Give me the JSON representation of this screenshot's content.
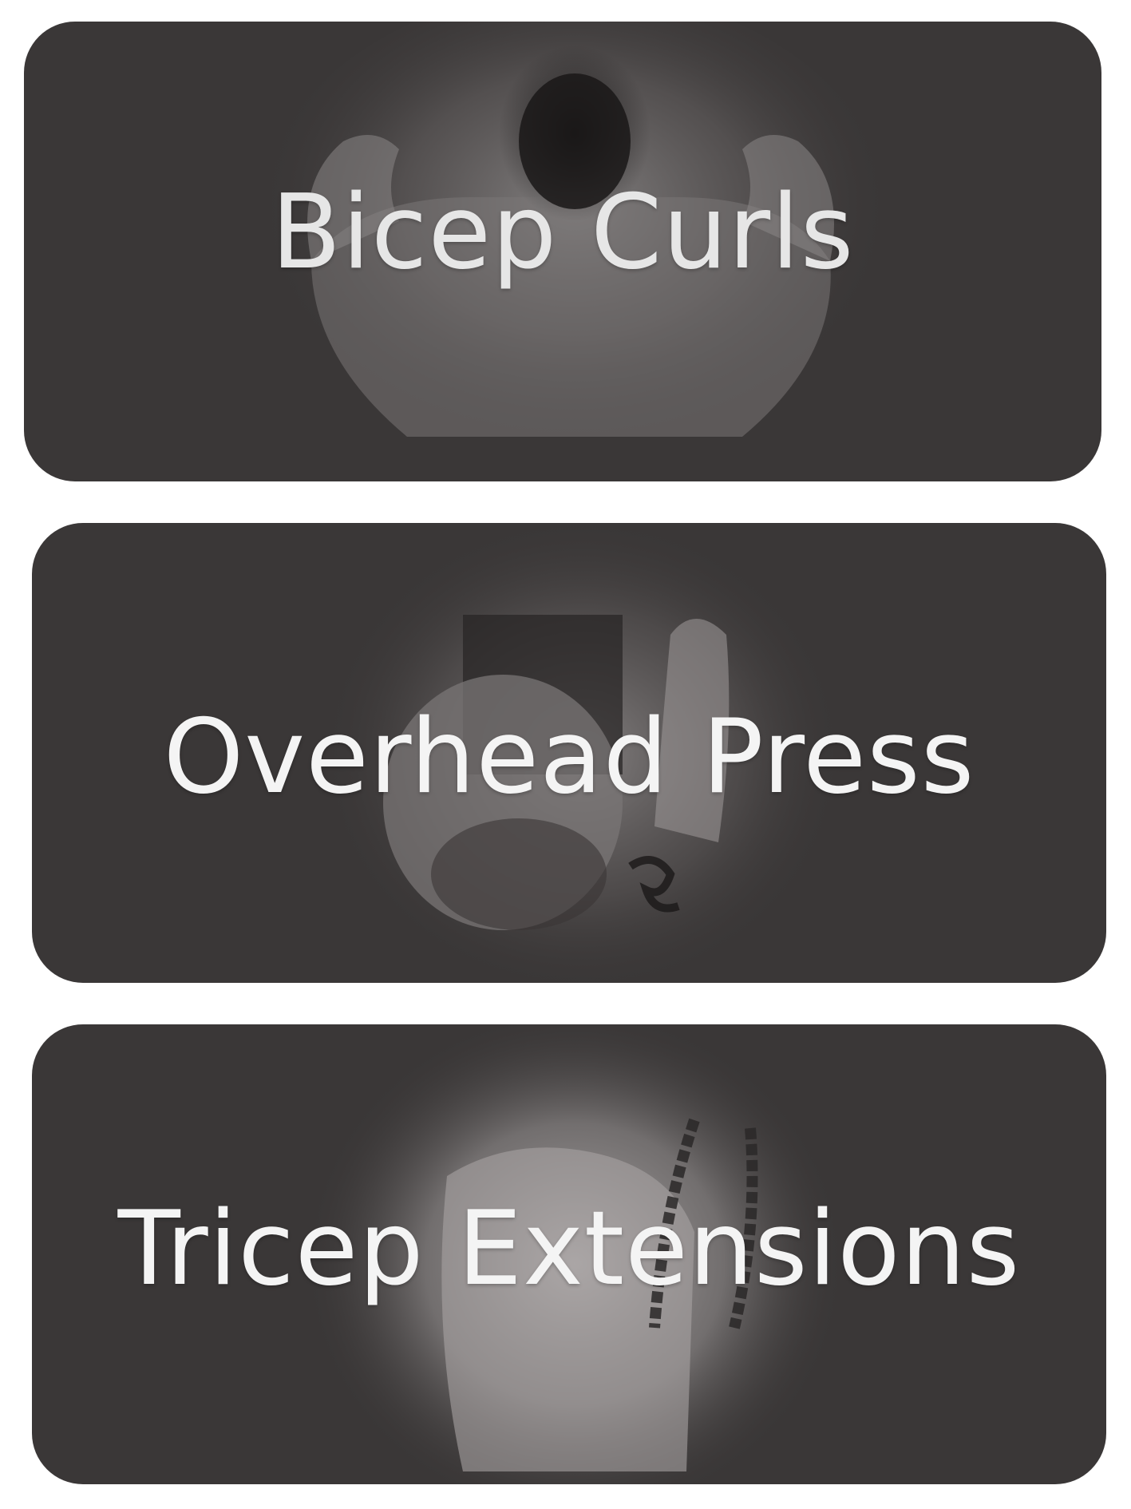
{
  "exercises": [
    {
      "label": "Bicep Curls",
      "image": "flexing-back-photo"
    },
    {
      "label": "Overhead Press",
      "image": "man-pressing-photo"
    },
    {
      "label": "Tricep Extensions",
      "image": "rope-extension-photo"
    }
  ],
  "colors": {
    "card_background": "#3a3737",
    "label_text": "#f4f4f4",
    "page_background": "#ffffff"
  }
}
